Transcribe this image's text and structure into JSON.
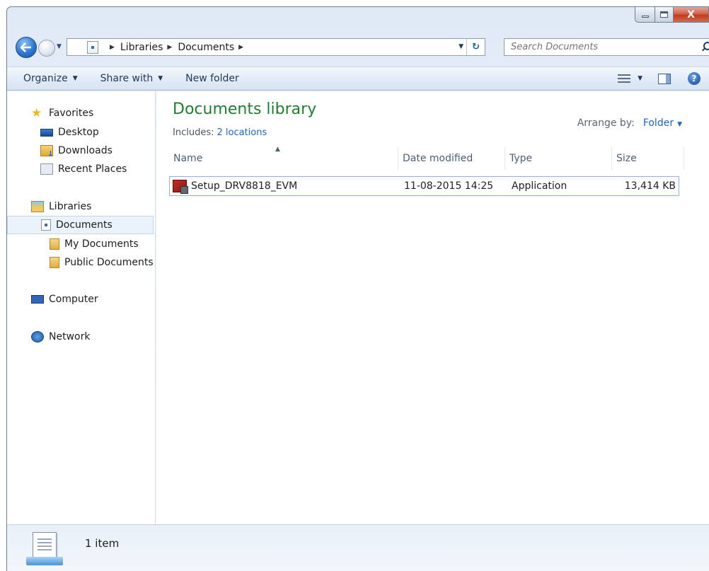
{
  "window": {
    "caption": {
      "minimize_icon": "minimize-icon",
      "maximize_icon": "maximize-icon",
      "close_label": "X"
    }
  },
  "addressbar": {
    "crumbs": [
      "Libraries",
      "Documents"
    ],
    "search_placeholder": "Search Documents"
  },
  "toolbar": {
    "organize": "Organize",
    "share_with": "Share with",
    "new_folder": "New folder",
    "help": "?"
  },
  "sidebar": {
    "favorites": {
      "label": "Favorites",
      "items": [
        "Desktop",
        "Downloads",
        "Recent Places"
      ]
    },
    "libraries": {
      "label": "Libraries",
      "documents": "Documents",
      "children": [
        "My Documents",
        "Public Documents"
      ]
    },
    "computer": "Computer",
    "network": "Network"
  },
  "library": {
    "title": "Documents library",
    "includes_label": "Includes:",
    "includes_link": "2 locations",
    "arrange_label": "Arrange by:",
    "arrange_value": "Folder"
  },
  "columns": {
    "name": "Name",
    "date": "Date modified",
    "type": "Type",
    "size": "Size"
  },
  "files": [
    {
      "name": "Setup_DRV8818_EVM",
      "date": "11-08-2015 14:25",
      "type": "Application",
      "size": "13,414 KB"
    }
  ],
  "status": {
    "count": "1 item"
  },
  "colors": {
    "title_green": "#1e7f2f",
    "link_blue": "#1c66c8",
    "selection_border": "#8fb3dc"
  }
}
